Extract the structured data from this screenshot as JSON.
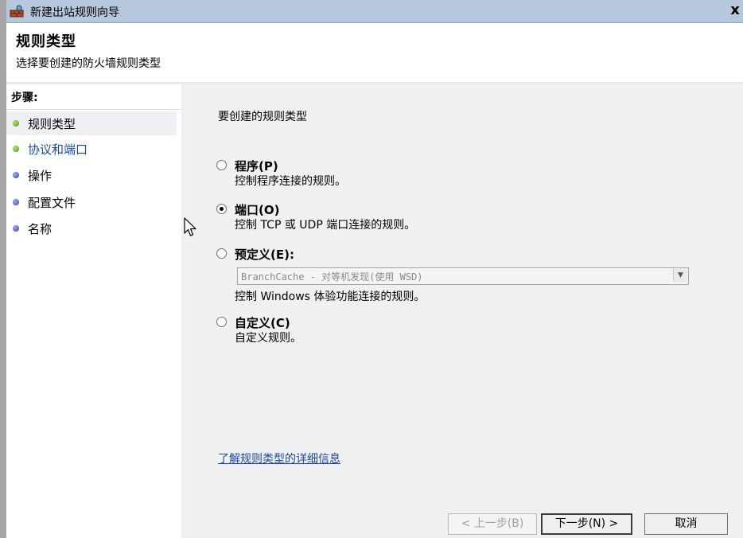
{
  "window": {
    "title": "新建出站规则向导",
    "close_label": "x"
  },
  "header": {
    "title": "规则类型",
    "subtitle": "选择要创建的防火墙规则类型"
  },
  "sidebar": {
    "steps_title": "步骤:",
    "items": [
      {
        "label": "规则类型",
        "state": "current",
        "dot": "green"
      },
      {
        "label": "协议和端口",
        "state": "link",
        "dot": "green"
      },
      {
        "label": "操作",
        "state": "pending",
        "dot": "blue"
      },
      {
        "label": "配置文件",
        "state": "pending",
        "dot": "blue"
      },
      {
        "label": "名称",
        "state": "pending",
        "dot": "blue"
      }
    ]
  },
  "main": {
    "prompt": "要创建的规则类型",
    "options": [
      {
        "label": "程序(P)",
        "description": "控制程序连接的规则。",
        "checked": false
      },
      {
        "label": "端口(O)",
        "description": "控制 TCP 或 UDP 端口连接的规则。",
        "checked": true
      },
      {
        "label": "预定义(E):",
        "description": "控制 Windows 体验功能连接的规则。",
        "checked": false
      },
      {
        "label": "自定义(C)",
        "description": "自定义规则。",
        "checked": false
      }
    ],
    "predefined_select_value": "BranchCache - 对等机发现(使用 WSD)",
    "learn_more_link": "了解规则类型的详细信息"
  },
  "buttons": {
    "back": "< 上一步(B)",
    "next": "下一步(N) >",
    "cancel": "取消"
  },
  "colors": {
    "title_bar": "#b6c8dc",
    "main_background": "#f0f0f0",
    "link": "#1a4aa8"
  }
}
